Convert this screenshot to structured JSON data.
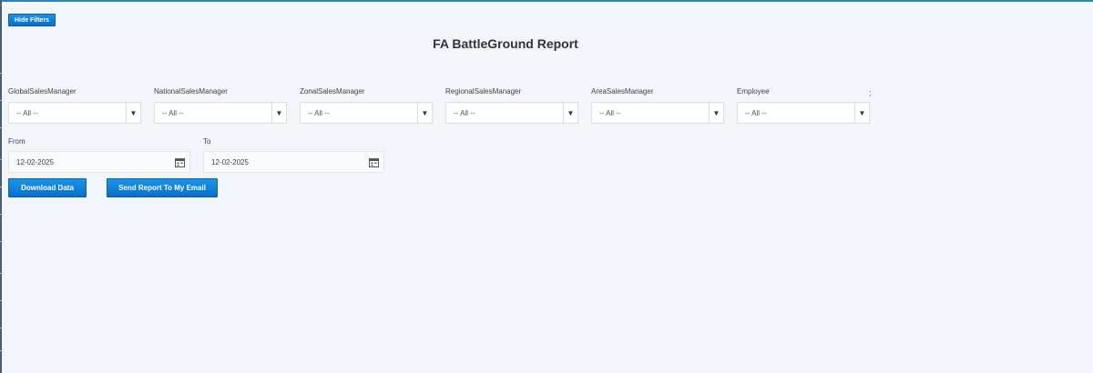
{
  "header": {
    "hide_filters_label": "Hide Filters",
    "title": "FA BattleGround Report"
  },
  "filters": [
    {
      "label": "GlobalSalesManager",
      "value": "-- All --"
    },
    {
      "label": "NationalSalesManager",
      "value": "-- All --"
    },
    {
      "label": "ZonalSalesManager",
      "value": "-- All --"
    },
    {
      "label": "RegionalSalesManager",
      "value": "-- All --"
    },
    {
      "label": "AreaSalesManager",
      "value": "-- All --"
    },
    {
      "label": "Employee",
      "value": "-- All --"
    }
  ],
  "stray_text": ";",
  "dates": {
    "from_label": "From",
    "from_value": "12-02-2025",
    "to_label": "To",
    "to_value": "12-02-2025"
  },
  "actions": {
    "download_label": "Download Data",
    "email_label": "Send Report To My Email"
  },
  "colors": {
    "background": "#f2f5f9",
    "button_primary": "#0a7fd9",
    "top_border": "#2a86b8"
  },
  "icons": {
    "dropdown": "triangle-down",
    "calendar": "calendar-icon"
  }
}
